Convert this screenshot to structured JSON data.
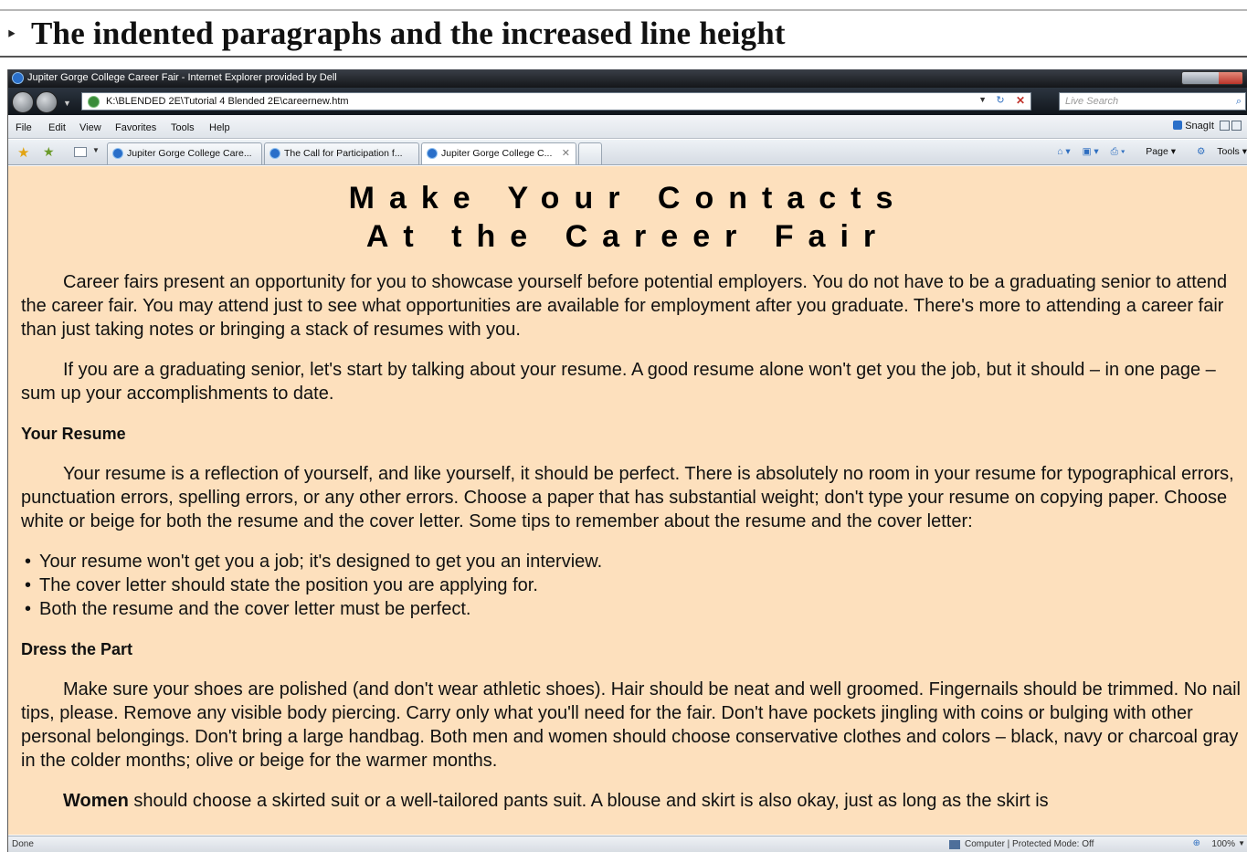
{
  "slide": {
    "caption": "The indented paragraphs and the increased line height"
  },
  "window": {
    "title": "Jupiter Gorge College Career Fair - Internet Explorer provided by Dell"
  },
  "address": {
    "url": "K:\\BLENDED 2E\\Tutorial 4 Blended 2E\\careernew.htm",
    "search_placeholder": "Live Search"
  },
  "menu": {
    "items": [
      "File",
      "Edit",
      "View",
      "Favorites",
      "Tools",
      "Help"
    ],
    "snagit": "SnagIt"
  },
  "tabs": [
    {
      "label": "Jupiter Gorge College Care..."
    },
    {
      "label": "The Call for Participation f..."
    },
    {
      "label": "Jupiter Gorge College C..."
    }
  ],
  "commandbar": {
    "page": "Page",
    "tools": "Tools"
  },
  "page": {
    "heading_line1": "Make Your Contacts",
    "heading_line2": "At the Career Fair",
    "p1": "Career fairs present an opportunity for you to showcase yourself before potential employers. You do not have to be a graduating senior to attend the career fair. You may attend just to see what opportunities are available for employment after you graduate. There's more to attending a career fair than just taking notes or bringing a stack of resumes with you.",
    "p2": "If you are a graduating senior, let's start by talking about your resume. A good resume alone won't get you the job, but it should – in one page – sum up your accomplishments to date.",
    "h_resume": "Your Resume",
    "p3": "Your resume is a reflection of yourself, and like yourself, it should be perfect. There is absolutely no room in your resume for typographical errors, punctuation errors, spelling errors, or any other errors. Choose a paper that has substantial weight; don't type your resume on copying paper. Choose white or beige for both the resume and the cover letter. Some tips to remember about the resume and the cover letter:",
    "tips": [
      "Your resume won't get you a job; it's designed to get you an interview.",
      "The cover letter should state the position you are applying for.",
      "Both the resume and the cover letter must be perfect."
    ],
    "h_dress": "Dress the Part",
    "p4": "Make sure your shoes are polished (and don't wear athletic shoes). Hair should be neat and well groomed. Fingernails should be trimmed. No nail tips, please. Remove any visible body piercing. Carry only what you'll need for the fair. Don't have pockets jingling with coins or bulging with other personal belongings. Don't bring a large handbag. Both men and women should choose conservative clothes and colors – black, navy or charcoal gray in the colder months; olive or beige for the warmer months.",
    "p5_bold": "Women",
    "p5_rest": " should choose a skirted suit or a well-tailored pants suit. A blouse and skirt is also okay, just as long as the skirt is"
  },
  "status": {
    "text": "Done",
    "zone": "Computer | Protected Mode: Off",
    "zoom": "100%"
  },
  "colors": {
    "page_background": "#fde0bd"
  }
}
